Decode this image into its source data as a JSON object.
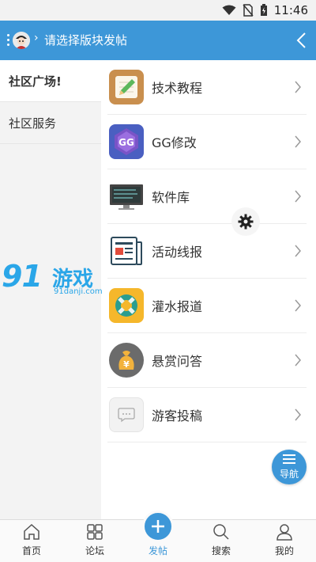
{
  "status_bar": {
    "time": "11:46"
  },
  "header": {
    "title": "请选择版块发帖",
    "separator": "›"
  },
  "left_nav": {
    "items": [
      {
        "label": "社区广场!"
      },
      {
        "label": "社区服务"
      }
    ]
  },
  "forums": [
    {
      "label": "技术教程",
      "icon": "pencil-notepad-icon"
    },
    {
      "label": "GG修改",
      "icon": "gg-logo-icon"
    },
    {
      "label": "软件库",
      "icon": "monitor-icon"
    },
    {
      "label": "活动线报",
      "icon": "newspaper-icon"
    },
    {
      "label": "灌水报道",
      "icon": "lifebuoy-icon"
    },
    {
      "label": "悬赏问答",
      "icon": "money-bag-icon"
    },
    {
      "label": "游客投稿",
      "icon": "chat-bubble-icon"
    }
  ],
  "watermark": {
    "big": "91",
    "cn": "游戏",
    "url": "91danji.com"
  },
  "nav_fab": {
    "label": "导航"
  },
  "tabbar": {
    "tabs": [
      {
        "label": "首页",
        "icon": "home-icon"
      },
      {
        "label": "论坛",
        "icon": "grid-icon"
      },
      {
        "label": "发帖",
        "icon": "plus-icon"
      },
      {
        "label": "搜索",
        "icon": "search-icon"
      },
      {
        "label": "我的",
        "icon": "user-icon"
      }
    ]
  },
  "colors": {
    "primary": "#3d97d8",
    "sidebar_bg": "#f3f3f3",
    "watermark": "#2aa6e8"
  }
}
